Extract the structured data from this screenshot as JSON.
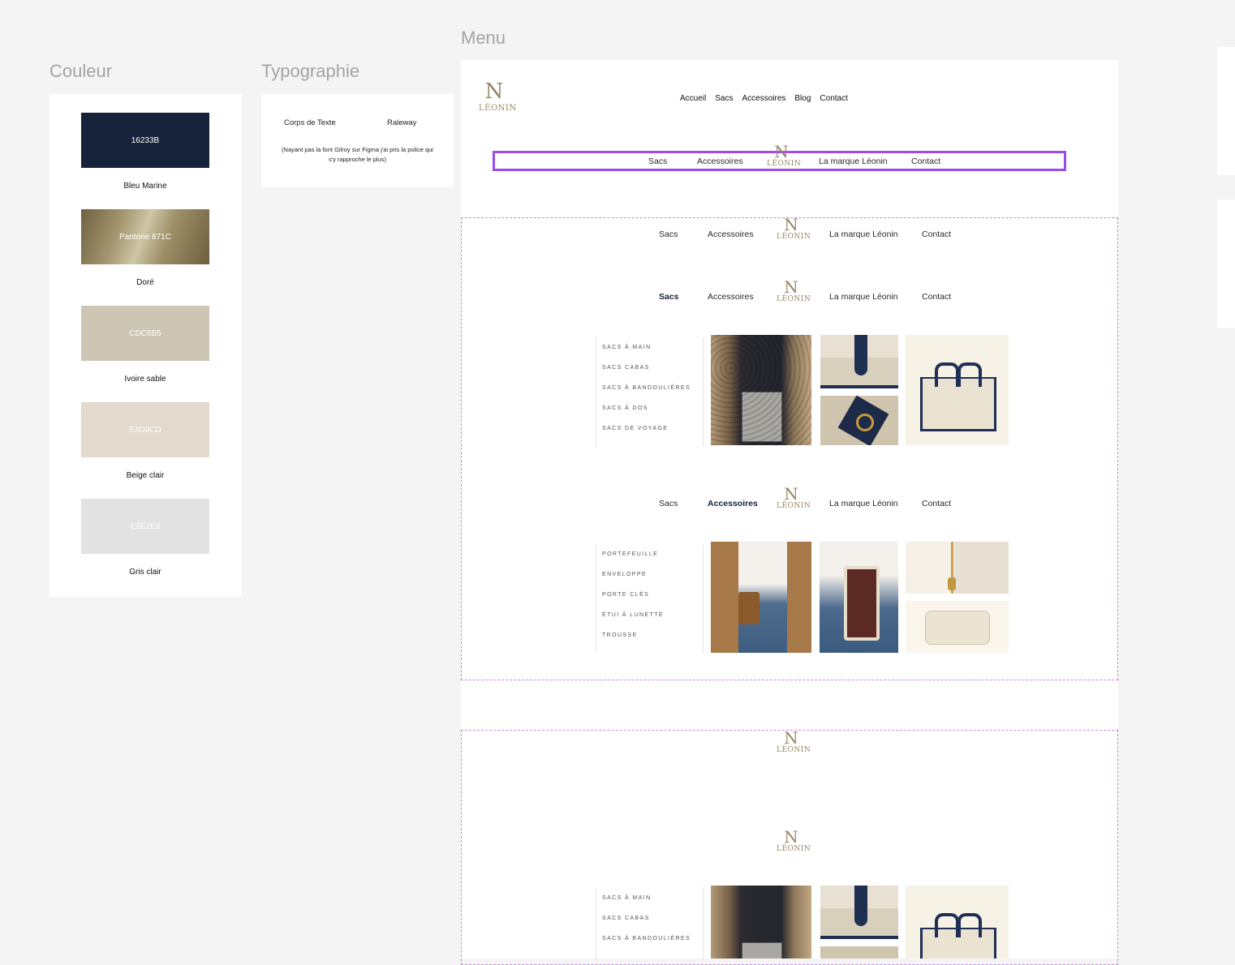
{
  "sections": {
    "couleur": "Couleur",
    "typographie": "Typographie",
    "menu": "Menu"
  },
  "colors": [
    {
      "code": "16233B",
      "name": "Bleu Marine",
      "hex": "#16233b"
    },
    {
      "code": "Pantone 871C",
      "name": "Doré",
      "hex": "#8a7a55"
    },
    {
      "code": "CDC6B5",
      "name": "Ivoire sable",
      "hex": "#cdc6b5"
    },
    {
      "code": "E3D9CD",
      "name": "Beige clair",
      "hex": "#e3d9cd"
    },
    {
      "code": "E2E2E2",
      "name": "Gris clair",
      "hex": "#e2e2e2"
    }
  ],
  "typography": {
    "label": "Corps de Texte",
    "font": "Raleway",
    "note": "(Nayant pas la font Gilroy sur Figma j'ai pris la police qui s'y rapproche le plus)"
  },
  "logo": {
    "word": "LÉONIN",
    "mark": "N"
  },
  "top_nav": [
    "Accueil",
    "Sacs",
    "Accessoires",
    "Blog",
    "Contact"
  ],
  "split_nav": {
    "left": [
      "Sacs",
      "Accessoires"
    ],
    "right": [
      "La marque Léonin",
      "Contact"
    ]
  },
  "bag_categories": [
    "SACS À MAIN",
    "SACS CABAS",
    "SACS À BANDOULIÈRES",
    "SACS À DOS",
    "SACS DE VOYAGE"
  ],
  "accessory_categories": [
    "PORTEFEUILLE",
    "ENVELOPPE",
    "PORTE CLÉS",
    "ÉTUI À LUNETTE",
    "TROUSSE"
  ],
  "partial_bag_categories": [
    "SACS À MAIN",
    "SACS CABAS",
    "SACS À BANDOULIÈRES"
  ],
  "accent": {
    "navy": "#16233b",
    "gold": "#9a8563",
    "selection": "#9b4de5",
    "dashed": "#c78ad8"
  }
}
